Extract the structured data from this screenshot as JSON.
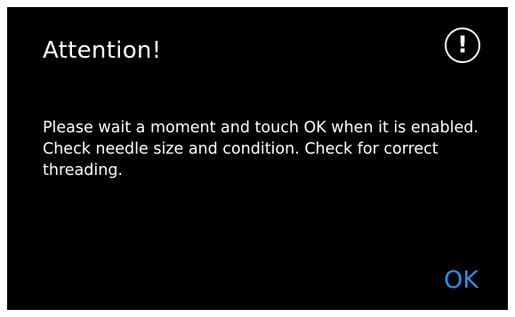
{
  "dialog": {
    "title": "Attention!",
    "icon": "exclamation-circle-icon",
    "icon_glyph": "!",
    "message": "Please wait a moment and touch OK when it is enabled. Check needle size and condition. Check for correct threading.",
    "ok_label": "OK"
  },
  "colors": {
    "background": "#000000",
    "text": "#ffffff",
    "accent": "#2f8fe6"
  }
}
